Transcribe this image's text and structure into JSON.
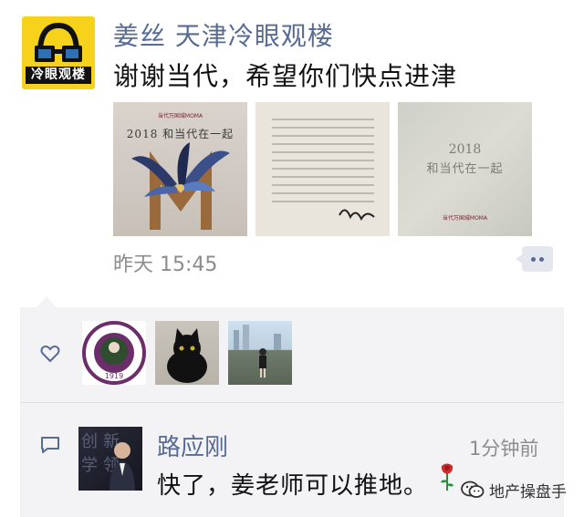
{
  "post": {
    "avatar_logo_text": "冷眼观楼",
    "author": "姜丝 天津冷眼观楼",
    "text": "谢谢当代，希望你们快点进津",
    "photos": [
      {
        "title_year": "2018",
        "title_text": "和当代在一起",
        "brand": "当代万国城MOMA"
      },
      {
        "kind": "letter"
      },
      {
        "title_year": "2018",
        "title_text": "和当代在一起",
        "brand": "当代万国城MOMA"
      }
    ],
    "time": "昨天 15:45"
  },
  "likes": {
    "icon": "heart-icon",
    "avatars": [
      "nankai-university-seal",
      "black-cat",
      "person-in-city"
    ],
    "seal_year": "1919"
  },
  "comment": {
    "icon": "comment-icon",
    "name": "路应刚",
    "time": "1分钟前",
    "text": "快了，姜老师可以推地。",
    "emoji": "rose-icon"
  },
  "watermark": {
    "icon": "wechat-official-account-icon",
    "text": "地产操盘手"
  },
  "colors": {
    "link": "#576b95",
    "panel_bg": "#f3f3f5",
    "avatar_yellow": "#f7d21a"
  }
}
